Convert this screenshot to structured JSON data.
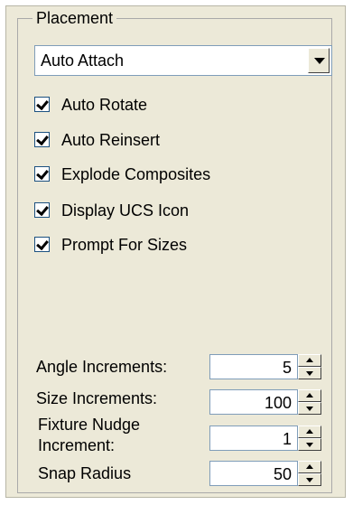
{
  "placement": {
    "legend": "Placement",
    "mode": {
      "value": "Auto Attach"
    },
    "checkboxes": [
      {
        "label": "Auto Rotate",
        "checked": true
      },
      {
        "label": "Auto Reinsert",
        "checked": true
      },
      {
        "label": "Explode Composites",
        "checked": true
      },
      {
        "label": "Display UCS Icon",
        "checked": true
      },
      {
        "label": "Prompt For Sizes",
        "checked": true
      }
    ],
    "spinners": [
      {
        "label": "Angle Increments:",
        "value": "5"
      },
      {
        "label": "Size Increments:",
        "value": "100"
      },
      {
        "label_line1": "Fixture Nudge",
        "label_line2": "Increment:",
        "value": "1"
      },
      {
        "label": "Snap Radius",
        "value": "50"
      }
    ]
  }
}
